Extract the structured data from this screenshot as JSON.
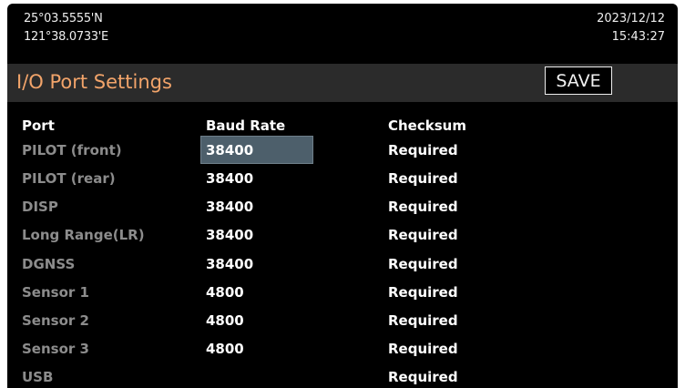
{
  "status": {
    "latitude": "25°03.5555'N",
    "longitude": "121°38.0733'E",
    "date": "2023/12/12",
    "time": "15:43:27"
  },
  "page": {
    "title": "I/O Port Settings",
    "save_label": "SAVE"
  },
  "table": {
    "headers": {
      "port": "Port",
      "baud": "Baud Rate",
      "checksum": "Checksum"
    },
    "rows": [
      {
        "port": "PILOT (front)",
        "baud": "38400",
        "checksum": "Required",
        "selected": true
      },
      {
        "port": "PILOT (rear)",
        "baud": "38400",
        "checksum": "Required"
      },
      {
        "port": "DISP",
        "baud": "38400",
        "checksum": "Required"
      },
      {
        "port": "Long Range(LR)",
        "baud": "38400",
        "checksum": "Required"
      },
      {
        "port": "DGNSS",
        "baud": "38400",
        "checksum": "Required"
      },
      {
        "port": "Sensor 1",
        "baud": "4800",
        "checksum": "Required"
      },
      {
        "port": "Sensor 2",
        "baud": "4800",
        "checksum": "Required"
      },
      {
        "port": "Sensor 3",
        "baud": "4800",
        "checksum": "Required"
      },
      {
        "port": "USB",
        "baud": "",
        "checksum": "Required"
      }
    ]
  },
  "colors": {
    "title": "#f2a46a",
    "port_label": "#8c8c8c",
    "selection": "#4d5f6b",
    "background": "#000000"
  }
}
